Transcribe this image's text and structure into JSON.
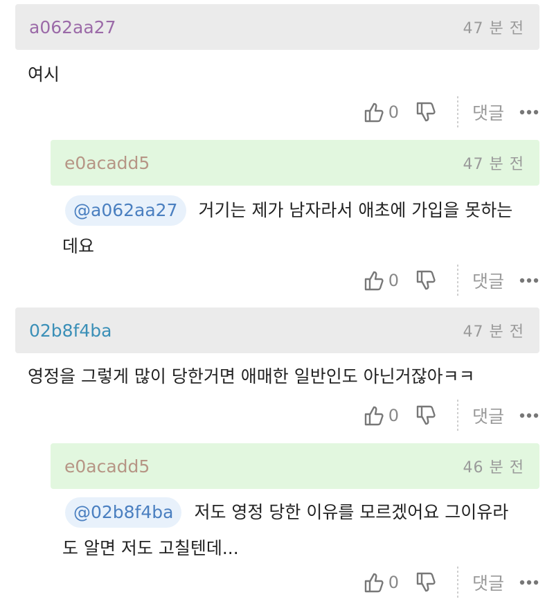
{
  "comments": [
    {
      "nickname": "a062aa27",
      "nick_color": "#9b6aa8",
      "time": "47 분 전",
      "text": "여시",
      "likes": "0",
      "reply_label": "댓글"
    },
    {
      "nickname": "e0acadd5",
      "nick_color": "#b69585",
      "time": "47 분 전",
      "mention": "@a062aa27",
      "text_line1": "거기는 제가 남자라서 애초에 가입을 못하는",
      "text_line2": "데요",
      "likes": "0",
      "reply_label": "댓글"
    },
    {
      "nickname": "02b8f4ba",
      "nick_color": "#3a8fb7",
      "time": "47 분 전",
      "text": "영정을 그렇게 많이 당한거면 애매한 일반인도 아닌거잖아ㅋㅋ",
      "likes": "0",
      "reply_label": "댓글"
    },
    {
      "nickname": "e0acadd5",
      "nick_color": "#b69585",
      "time": "46 분 전",
      "mention": "@02b8f4ba",
      "text_line1": "저도 영정 당한 이유를 모르겠어요 그이유라",
      "text_line2": "도 알면 저도 고칠텐데...",
      "likes": "0",
      "reply_label": "댓글"
    }
  ]
}
